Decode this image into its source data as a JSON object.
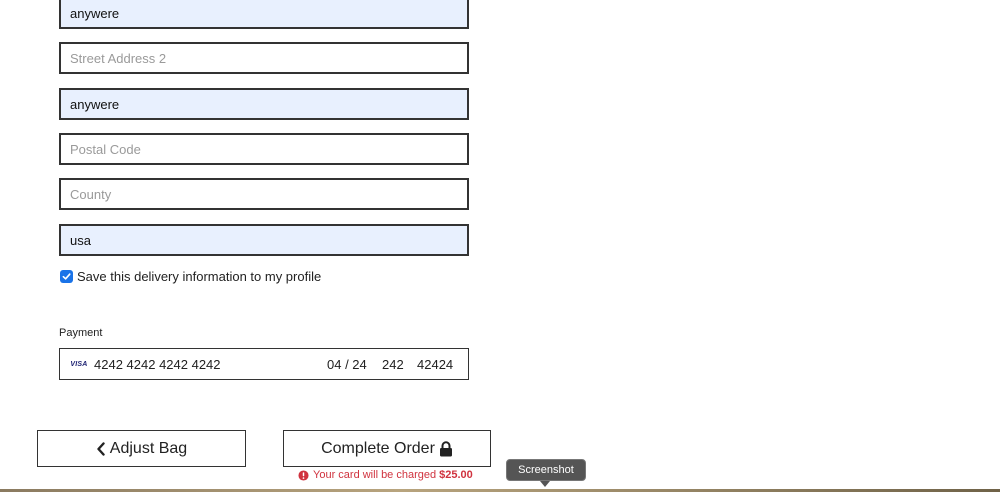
{
  "form": {
    "street1_value": "anywere",
    "street2_placeholder": "Street Address 2",
    "city_value": "anywere",
    "postal_placeholder": "Postal Code",
    "county_placeholder": "County",
    "country_value": "usa",
    "save_profile_label": "Save this delivery information to my profile",
    "save_profile_checked": true
  },
  "payment": {
    "label": "Payment",
    "card_brand": "VISA",
    "card_number": "4242 4242 4242 4242",
    "expiry": "04 / 24",
    "cvc": "242",
    "zip": "42424"
  },
  "actions": {
    "adjust_bag_label": "Adjust Bag",
    "complete_order_label": "Complete Order",
    "charge_note_prefix": "Your card will be charged",
    "charge_amount": "$25.00"
  },
  "tooltip": {
    "text": "Screenshot"
  },
  "colors": {
    "autofill_bg": "#e8f0fe",
    "checkbox": "#1a73e8",
    "error": "#d0333f"
  }
}
